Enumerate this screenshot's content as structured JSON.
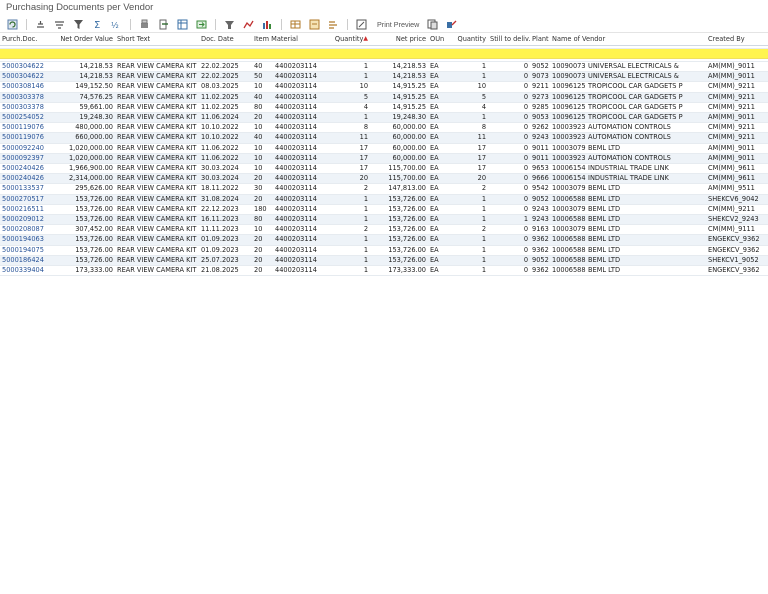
{
  "window": {
    "title": "Purchasing Documents per Vendor"
  },
  "toolbar": {
    "icons": [
      "refresh-icon",
      "details-icon",
      "sort-ascending-icon",
      "filter-icon",
      "total-icon",
      "subtotal-icon",
      "print-icon",
      "export-icon",
      "layout-icon",
      "arrow-icon",
      "settings-icon",
      "graph-icon",
      "chart-icon",
      "table-icon",
      "select-icon",
      "choose-icon",
      "help-icon"
    ],
    "print_preview_label": "Print Preview"
  },
  "columns": [
    "Purch.Doc.",
    "Net Order Value",
    "Short Text",
    "Doc. Date",
    "Item",
    "Material",
    "Quantity",
    "Net price",
    "OUn",
    "Quantity",
    "Still to deliv.",
    "Plant",
    "Name of Vendor",
    "Created By"
  ],
  "rows": [
    [
      "5000304622",
      "14,218.53",
      "REAR VIEW CAMERA KIT",
      "22.02.2025",
      "40",
      "4400203114",
      "1",
      "14,218.53",
      "EA",
      "1",
      "0",
      "9052",
      "10090073",
      "UNIVERSAL ELECTRICALS &",
      "AM(MM)_9011"
    ],
    [
      "5000304622",
      "14,218.53",
      "REAR VIEW CAMERA KIT",
      "22.02.2025",
      "50",
      "4400203114",
      "1",
      "14,218.53",
      "EA",
      "1",
      "0",
      "9073",
      "10090073",
      "UNIVERSAL ELECTRICALS &",
      "AM(MM)_9011"
    ],
    [
      "5000308146",
      "149,152.50",
      "REAR VIEW CAMERA KIT",
      "08.03.2025",
      "10",
      "4400203114",
      "10",
      "14,915.25",
      "EA",
      "10",
      "0",
      "9211",
      "10096125",
      "TROPICOOL CAR GADGETS P",
      "CM(MM)_9211"
    ],
    [
      "5000303378",
      "74,576.25",
      "REAR VIEW CAMERA KIT",
      "11.02.2025",
      "40",
      "4400203114",
      "5",
      "14,915.25",
      "EA",
      "5",
      "0",
      "9273",
      "10096125",
      "TROPICOOL CAR GADGETS P",
      "CM(MM)_9211"
    ],
    [
      "5000303378",
      "59,661.00",
      "REAR VIEW CAMERA KIT",
      "11.02.2025",
      "80",
      "4400203114",
      "4",
      "14,915.25",
      "EA",
      "4",
      "0",
      "9285",
      "10096125",
      "TROPICOOL CAR GADGETS P",
      "CM(MM)_9211"
    ],
    [
      "5000254052",
      "19,248.30",
      "REAR VIEW CAMERA KIT",
      "11.06.2024",
      "20",
      "4400203114",
      "1",
      "19,248.30",
      "EA",
      "1",
      "0",
      "9053",
      "10096125",
      "TROPICOOL CAR GADGETS P",
      "AM(MM)_9011"
    ],
    [
      "5000119076",
      "480,000.00",
      "REAR VIEW CAMERA KIT",
      "10.10.2022",
      "10",
      "4400203114",
      "8",
      "60,000.00",
      "EA",
      "8",
      "0",
      "9262",
      "10003923",
      "AUTOMATION CONTROLS",
      "CM(MM)_9211"
    ],
    [
      "5000119076",
      "660,000.00",
      "REAR VIEW CAMERA KIT",
      "10.10.2022",
      "40",
      "4400203114",
      "11",
      "60,000.00",
      "EA",
      "11",
      "0",
      "9243",
      "10003923",
      "AUTOMATION CONTROLS",
      "CM(MM)_9211"
    ],
    [
      "5000092240",
      "1,020,000.00",
      "REAR VIEW CAMERA KIT",
      "11.06.2022",
      "10",
      "4400203114",
      "17",
      "60,000.00",
      "EA",
      "17",
      "0",
      "9011",
      "10003079",
      "BEML LTD",
      "AM(MM)_9011"
    ],
    [
      "5000092397",
      "1,020,000.00",
      "REAR VIEW CAMERA KIT",
      "11.06.2022",
      "10",
      "4400203114",
      "17",
      "60,000.00",
      "EA",
      "17",
      "0",
      "9011",
      "10003923",
      "AUTOMATION CONTROLS",
      "AM(MM)_9011"
    ],
    [
      "5000240426",
      "1,966,900.00",
      "REAR VIEW CAMERA KIT",
      "30.03.2024",
      "10",
      "4400203114",
      "17",
      "115,700.00",
      "EA",
      "17",
      "0",
      "9653",
      "10006154",
      "INDUSTRIAL TRADE LINK",
      "CM(MM)_9611"
    ],
    [
      "5000240426",
      "2,314,000.00",
      "REAR VIEW CAMERA KIT",
      "30.03.2024",
      "20",
      "4400203114",
      "20",
      "115,700.00",
      "EA",
      "20",
      "0",
      "9666",
      "10006154",
      "INDUSTRIAL TRADE LINK",
      "CM(MM)_9611"
    ],
    [
      "5000133537",
      "295,626.00",
      "REAR VIEW CAMERA KIT",
      "18.11.2022",
      "30",
      "4400203114",
      "2",
      "147,813.00",
      "EA",
      "2",
      "0",
      "9542",
      "10003079",
      "BEML LTD",
      "AM(MM)_9511"
    ],
    [
      "5000270517",
      "153,726.00",
      "REAR VIEW CAMERA KIT",
      "31.08.2024",
      "20",
      "4400203114",
      "1",
      "153,726.00",
      "EA",
      "1",
      "0",
      "9052",
      "10006588",
      "BEML LTD",
      "SHEKCV6_9042"
    ],
    [
      "5000216511",
      "153,726.00",
      "REAR VIEW CAMERA KIT",
      "22.12.2023",
      "180",
      "4400203114",
      "1",
      "153,726.00",
      "EA",
      "1",
      "0",
      "9243",
      "10003079",
      "BEML LTD",
      "CM(MM)_9211"
    ],
    [
      "5000209012",
      "153,726.00",
      "REAR VIEW CAMERA KIT",
      "16.11.2023",
      "80",
      "4400203114",
      "1",
      "153,726.00",
      "EA",
      "1",
      "1",
      "9243",
      "10006588",
      "BEML LTD",
      "SHEKCV2_9243"
    ],
    [
      "5000208087",
      "307,452.00",
      "REAR VIEW CAMERA KIT",
      "11.11.2023",
      "10",
      "4400203114",
      "2",
      "153,726.00",
      "EA",
      "2",
      "0",
      "9163",
      "10003079",
      "BEML LTD",
      "CM(MM)_9111"
    ],
    [
      "5000194063",
      "153,726.00",
      "REAR VIEW CAMERA KIT",
      "01.09.2023",
      "20",
      "4400203114",
      "1",
      "153,726.00",
      "EA",
      "1",
      "0",
      "9362",
      "10006588",
      "BEML LTD",
      "ENGEKCV_9362"
    ],
    [
      "5000194075",
      "153,726.00",
      "REAR VIEW CAMERA KIT",
      "01.09.2023",
      "20",
      "4400203114",
      "1",
      "153,726.00",
      "EA",
      "1",
      "0",
      "9362",
      "10006588",
      "BEML LTD",
      "ENGEKCV_9362"
    ],
    [
      "5000186424",
      "153,726.00",
      "REAR VIEW CAMERA KIT",
      "25.07.2023",
      "20",
      "4400203114",
      "1",
      "153,726.00",
      "EA",
      "1",
      "0",
      "9052",
      "10006588",
      "BEML LTD",
      "SHEKCV1_9052"
    ],
    [
      "5000339404",
      "173,333.00",
      "REAR VIEW CAMERA KIT",
      "21.08.2025",
      "20",
      "4400203114",
      "1",
      "173,333.00",
      "EA",
      "1",
      "0",
      "9362",
      "10006588",
      "BEML LTD",
      "ENGEKCV_9362"
    ]
  ]
}
